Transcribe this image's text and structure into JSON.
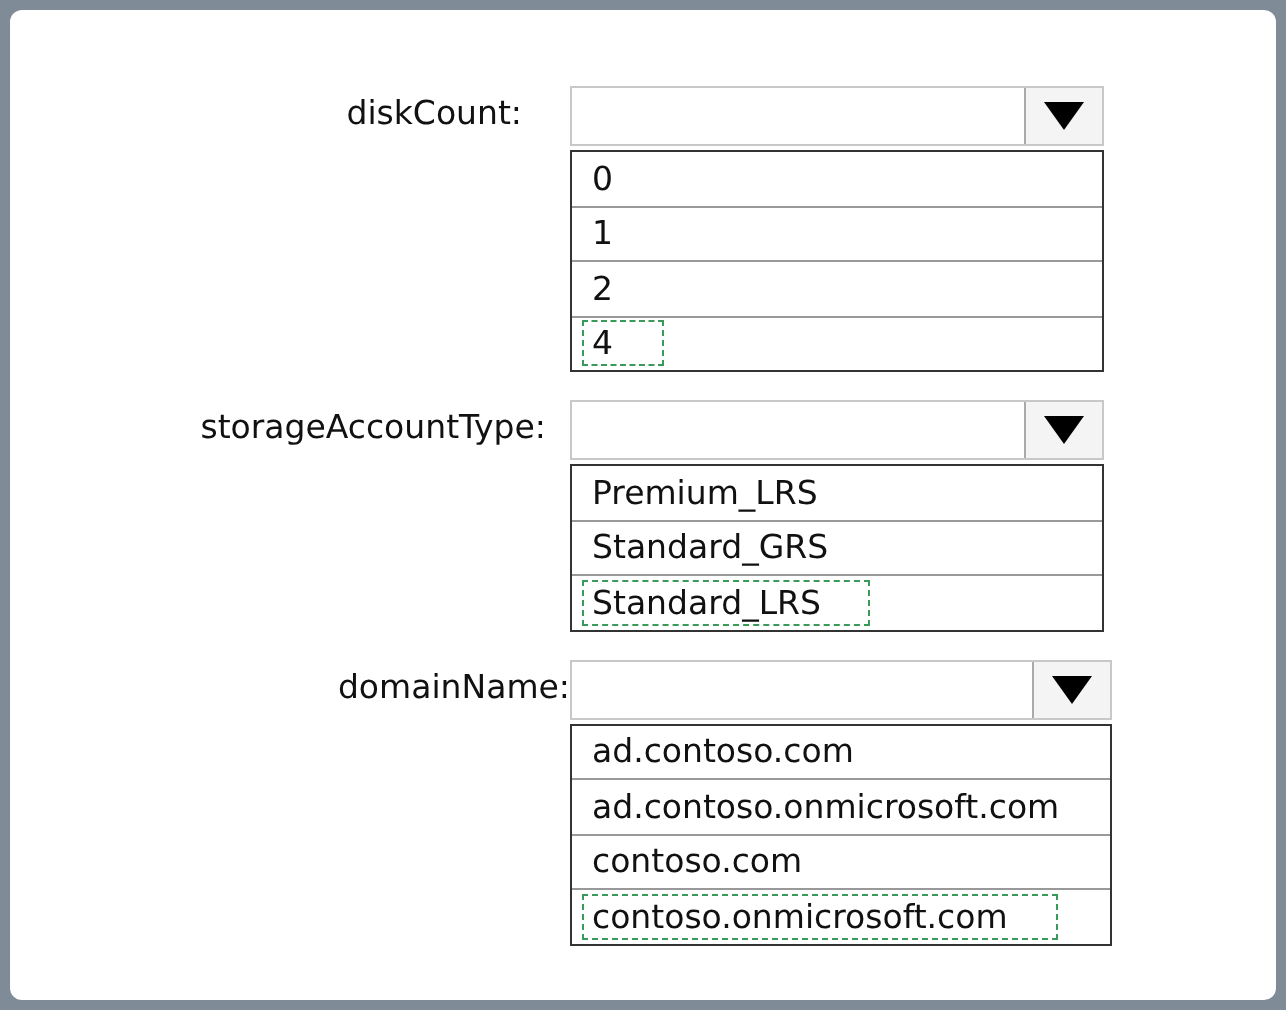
{
  "fields": [
    {
      "label": "diskCount:",
      "options": [
        {
          "text": "0",
          "selected": false
        },
        {
          "text": "1",
          "selected": false
        },
        {
          "text": "2",
          "selected": false
        },
        {
          "text": "4",
          "selected": true
        }
      ]
    },
    {
      "label": "storageAccountType:",
      "options": [
        {
          "text": "Premium_LRS",
          "selected": false
        },
        {
          "text": "Standard_GRS",
          "selected": false
        },
        {
          "text": "Standard_LRS",
          "selected": true
        }
      ]
    },
    {
      "label": "domainName:",
      "options": [
        {
          "text": "ad.contoso.com",
          "selected": false
        },
        {
          "text": "ad.contoso.onmicrosoft.com",
          "selected": false
        },
        {
          "text": "contoso.com",
          "selected": false
        },
        {
          "text": "contoso.onmicrosoft.com",
          "selected": true
        }
      ]
    }
  ]
}
